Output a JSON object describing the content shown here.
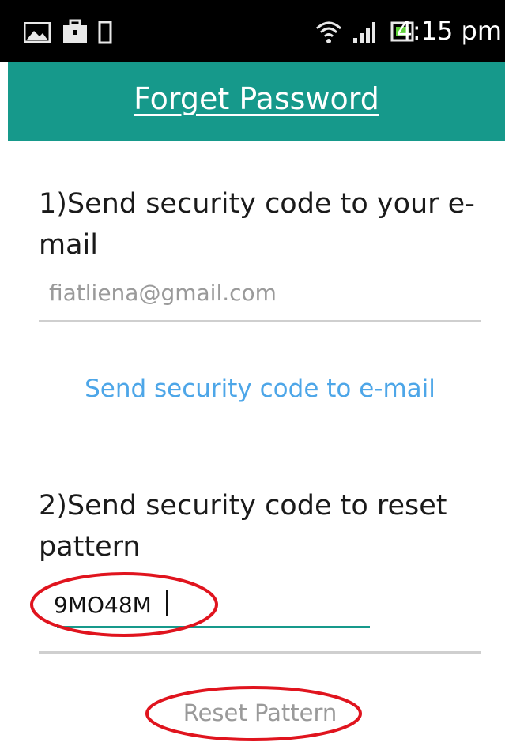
{
  "status_bar": {
    "time": "4:15 pm",
    "left_icons": [
      "picture-icon",
      "briefcase-icon",
      "phone-outline-icon"
    ],
    "right_icons": [
      "wifi-icon",
      "signal-icon",
      "battery-icon"
    ]
  },
  "toolbar": {
    "title": "Forget Password"
  },
  "email_section": {
    "heading": "1)Send security code to your e-mail",
    "email_value": "fiatliena@gmail.com",
    "send_button_label": "Send security code to e-mail"
  },
  "reset_section": {
    "heading": "2)Send security code to reset pattern",
    "code_value": "9MO48M",
    "reset_button_label": "Reset Pattern"
  },
  "colors": {
    "toolbar": "#16998b",
    "link": "#4da6e8",
    "annotation": "#e0141e"
  }
}
